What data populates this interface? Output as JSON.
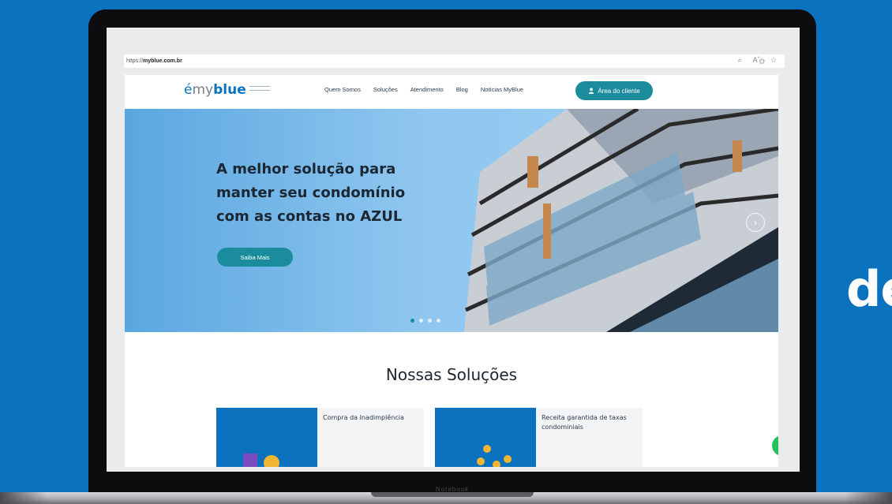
{
  "browser": {
    "url_prefix": "https://",
    "url_domain": "myblue.com.br"
  },
  "logo": {
    "mark": "é",
    "my": "my",
    "blue": "blue"
  },
  "nav": {
    "items": [
      "Quem Somos",
      "Soluções",
      "Atendimento",
      "Blog",
      "Notícias MyBlue"
    ],
    "client_button": "Área do cliente"
  },
  "hero": {
    "title_lines": [
      "A melhor solução para",
      "manter seu condomínio",
      "com as contas no AZUL"
    ],
    "button": "Saiba Mais",
    "slide_count": 4,
    "active_slide": 1
  },
  "solutions": {
    "title": "Nossas Soluções",
    "cards": [
      {
        "label": "Compra da Inadimplência"
      },
      {
        "label": "Receita garantida de taxas condominiais"
      }
    ]
  },
  "laptop": {
    "label": "Notebook"
  },
  "side_text": "de",
  "colors": {
    "background": "#0a72bf",
    "accent": "#1a8c9c",
    "brand": "#0a72bf"
  }
}
